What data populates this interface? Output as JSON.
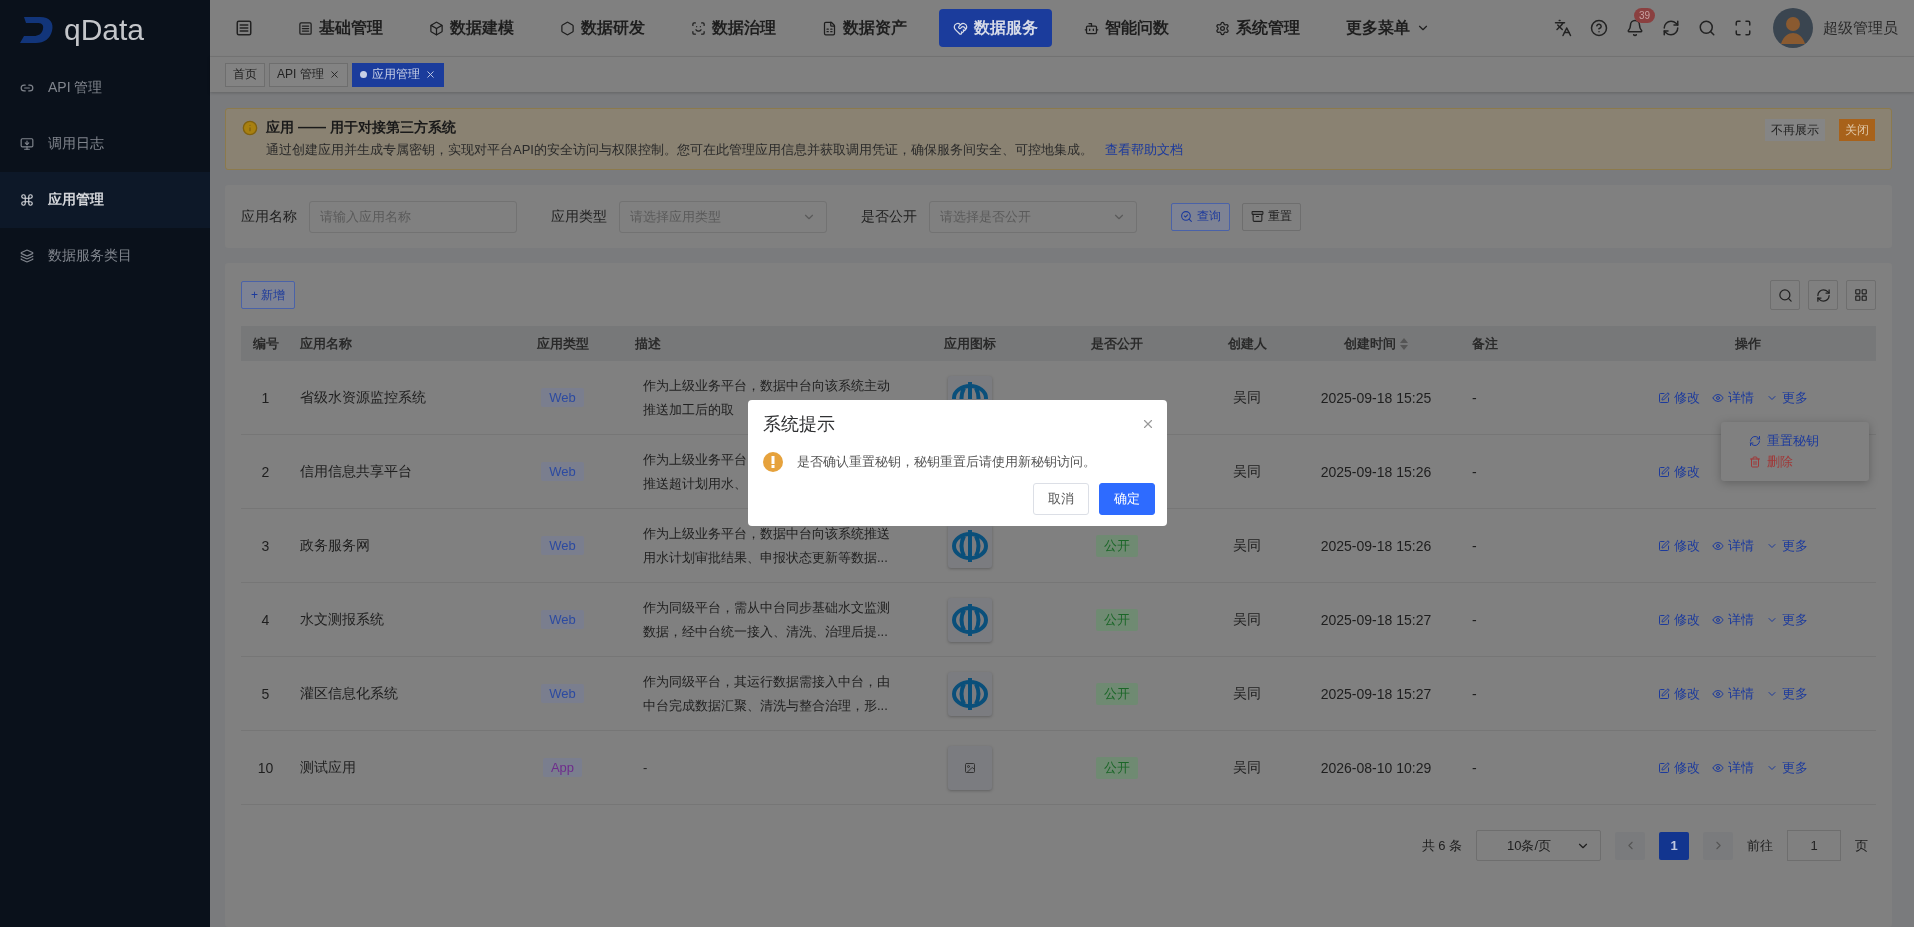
{
  "sidebar": {
    "logo_text": "qData",
    "items": [
      {
        "label": "API 管理",
        "selected": false
      },
      {
        "label": "调用日志",
        "selected": false
      },
      {
        "label": "应用管理",
        "selected": true
      },
      {
        "label": "数据服务类目",
        "selected": false
      }
    ]
  },
  "top_nav": {
    "items": [
      {
        "label": "基础管理",
        "selected": false,
        "has_menu": false
      },
      {
        "label": "数据建模",
        "selected": false,
        "has_menu": false
      },
      {
        "label": "数据研发",
        "selected": false,
        "has_menu": false
      },
      {
        "label": "数据治理",
        "selected": false,
        "has_menu": false
      },
      {
        "label": "数据资产",
        "selected": false,
        "has_menu": false
      },
      {
        "label": "数据服务",
        "selected": true,
        "has_menu": false
      },
      {
        "label": "智能问数",
        "selected": false,
        "has_menu": false
      },
      {
        "label": "系统管理",
        "selected": false,
        "has_menu": false
      },
      {
        "label": "更多菜单",
        "selected": false,
        "has_menu": true
      }
    ],
    "notification_count": "39",
    "user_name": "超级管理员"
  },
  "tabs": [
    {
      "label": "首页",
      "closable": false,
      "selected": false
    },
    {
      "label": "API 管理",
      "closable": true,
      "selected": false
    },
    {
      "label": "应用管理",
      "closable": true,
      "selected": true
    }
  ],
  "alert": {
    "title": "应用 —— 用于对接第三方系统",
    "text": "通过创建应用并生成专属密钥，实现对平台API的安全访问与权限控制。您可在此管理应用信息并获取调用凭证，确保服务间安全、可控地集成。",
    "link": "查看帮助文档",
    "buttons": [
      {
        "label": "不再展示",
        "kind": "plain"
      },
      {
        "label": "关闭",
        "kind": "warning"
      }
    ]
  },
  "filters": [
    {
      "label": "应用名称",
      "kind": "input",
      "placeholder": "请输入应用名称"
    },
    {
      "label": "应用类型",
      "kind": "select",
      "placeholder": "请选择应用类型"
    },
    {
      "label": "是否公开",
      "kind": "select",
      "placeholder": "请选择是否公开"
    }
  ],
  "filter_buttons": [
    {
      "label": "查询",
      "kind": "primary"
    },
    {
      "label": "重置",
      "kind": "default"
    }
  ],
  "add_button": "+ 新增",
  "table": {
    "columns": [
      {
        "label": "编号",
        "sortable": false
      },
      {
        "label": "应用名称",
        "sortable": false
      },
      {
        "label": "应用类型",
        "sortable": false
      },
      {
        "label": "描述",
        "sortable": false
      },
      {
        "label": "应用图标",
        "sortable": false
      },
      {
        "label": "是否公开",
        "sortable": false
      },
      {
        "label": "创建人",
        "sortable": false
      },
      {
        "label": "创建时间",
        "sortable": true
      },
      {
        "label": "备注",
        "sortable": false
      },
      {
        "label": "操作",
        "sortable": false
      }
    ],
    "rows": [
      {
        "id": "1",
        "name": "省级水资源监控系统",
        "type": {
          "label": "Web",
          "color": "#2c4aa0"
        },
        "description": [
          "作为上级业务平台，数据中台向该系统主动",
          "推送加工后的取"
        ],
        "app_icon": {
          "kind": "logo"
        },
        "creator": "吴同",
        "created": "2025-09-18 15:25",
        "remark": "-",
        "actions": [
          {
            "label": "修改",
            "kind": "edit"
          },
          {
            "label": "详情",
            "kind": "view"
          },
          {
            "label": "更多",
            "kind": "more"
          }
        ]
      },
      {
        "id": "2",
        "name": "信用信息共享平台",
        "type": {
          "label": "Web",
          "color": "#2c4aa0"
        },
        "description": [
          "作为上级业务平台",
          "推送超计划用水、"
        ],
        "creator": "吴同",
        "created": "2025-09-18 15:26",
        "remark": "-",
        "actions": [
          {
            "label": "修改",
            "kind": "edit"
          }
        ]
      },
      {
        "id": "3",
        "name": "政务服务网",
        "type": {
          "label": "Web",
          "color": "#2c4aa0"
        },
        "description": [
          "作为上级业务平台，数据中台向该系统推送",
          "用水计划审批结果、申报状态更新等数据..."
        ],
        "app_icon": {
          "kind": "logo"
        },
        "public": "公开",
        "creator": "吴同",
        "created": "2025-09-18 15:26",
        "remark": "-",
        "actions": [
          {
            "label": "修改",
            "kind": "edit"
          },
          {
            "label": "详情",
            "kind": "view"
          },
          {
            "label": "更多",
            "kind": "more"
          }
        ]
      },
      {
        "id": "4",
        "name": "水文测报系统",
        "type": {
          "label": "Web",
          "color": "#2c4aa0"
        },
        "description": [
          "作为同级平台，需从中台同步基础水文监测",
          "数据，经中台统一接入、清洗、治理后提..."
        ],
        "app_icon": {
          "kind": "logo"
        },
        "public": "公开",
        "creator": "吴同",
        "created": "2025-09-18 15:27",
        "remark": "-",
        "actions": [
          {
            "label": "修改",
            "kind": "edit"
          },
          {
            "label": "详情",
            "kind": "view"
          },
          {
            "label": "更多",
            "kind": "more"
          }
        ]
      },
      {
        "id": "5",
        "name": "灌区信息化系统",
        "type": {
          "label": "Web",
          "color": "#2c4aa0"
        },
        "description": [
          "作为同级平台，其运行数据需接入中台，由",
          "中台完成数据汇聚、清洗与整合治理，形..."
        ],
        "app_icon": {
          "kind": "logo"
        },
        "public": "公开",
        "creator": "吴同",
        "created": "2025-09-18 15:27",
        "remark": "-",
        "actions": [
          {
            "label": "修改",
            "kind": "edit"
          },
          {
            "label": "详情",
            "kind": "view"
          },
          {
            "label": "更多",
            "kind": "more"
          }
        ]
      },
      {
        "id": "10",
        "name": "测试应用",
        "type": {
          "label": "App",
          "color": "#6e2c8c"
        },
        "description": [
          "-"
        ],
        "app_icon": {
          "kind": "placeholder"
        },
        "public": "公开",
        "creator": "吴同",
        "created": "2026-08-10 10:29",
        "remark": "-",
        "actions": [
          {
            "label": "修改",
            "kind": "edit"
          },
          {
            "label": "详情",
            "kind": "view"
          },
          {
            "label": "更多",
            "kind": "more"
          }
        ]
      }
    ]
  },
  "row_menu": {
    "items": [
      {
        "label": "重置秘钥",
        "kind": "reset"
      },
      {
        "label": "删除",
        "kind": "delete"
      }
    ]
  },
  "pagination": {
    "total": "共 6 条",
    "page_size": "10条/页",
    "pages": [
      {
        "label": "1",
        "selected": true
      }
    ],
    "goto_label": "前往",
    "goto_value": "1",
    "page_suffix": "页"
  },
  "dialog": {
    "title": "系统提示",
    "message": "是否确认重置秘钥，秘钥重置后请使用新秘钥访问。",
    "buttons": [
      {
        "label": "取消",
        "kind": "default"
      },
      {
        "label": "确定",
        "kind": "primary"
      }
    ]
  }
}
